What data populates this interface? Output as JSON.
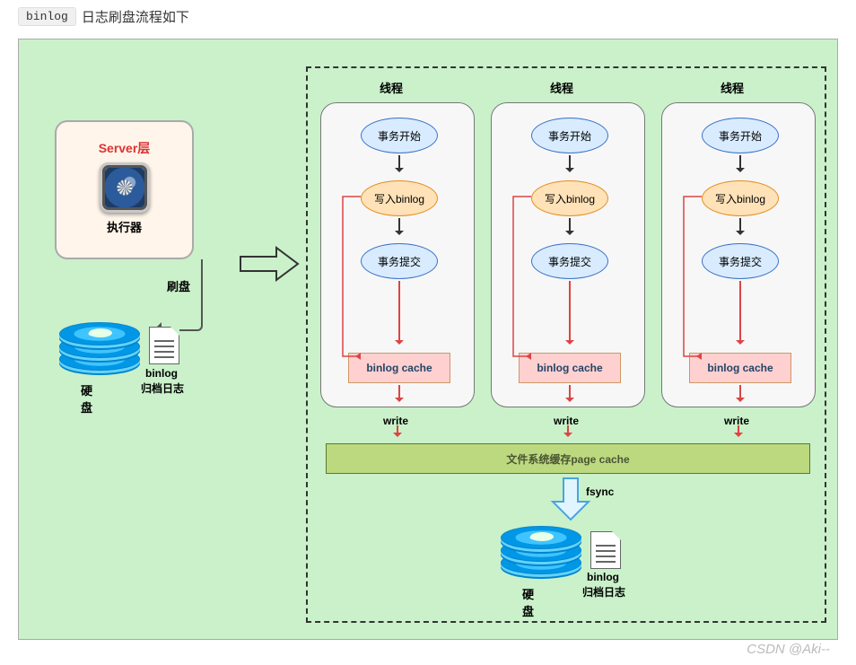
{
  "title_prefix_code": "binlog",
  "title_text": "日志刷盘流程如下",
  "server_box": {
    "title": "Server层",
    "executor": "执行器"
  },
  "left_disk": {
    "label": "硬盘",
    "file_title": "binlog",
    "file_sub": "归档日志",
    "flush_label": "刷盘"
  },
  "threads": {
    "heading": "线程",
    "steps": {
      "start": "事务开始",
      "write_binlog": "写入binlog",
      "commit": "事务提交"
    },
    "cache_box": "binlog cache",
    "write_label": "write"
  },
  "page_cache": "文件系统缓存page cache",
  "fsync_label": "fsync",
  "bottom_disk": {
    "label": "硬盘",
    "file_title": "binlog",
    "file_sub": "归档日志"
  },
  "watermark": "CSDN @Aki--"
}
